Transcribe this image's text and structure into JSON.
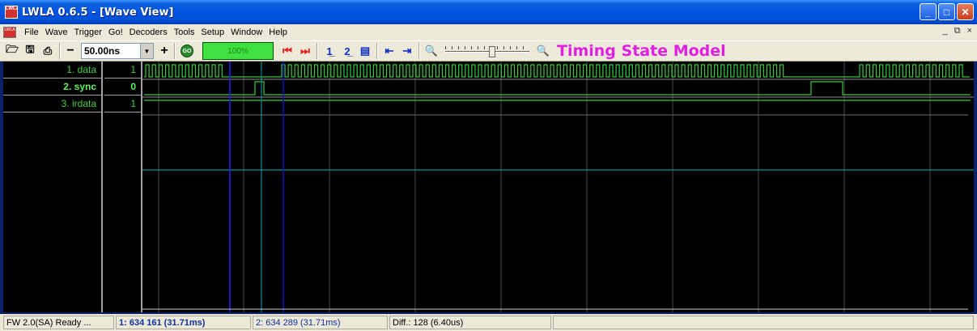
{
  "window": {
    "title": "LWLA 0.6.5 - [Wave View]",
    "icon": "lwla-app-icon"
  },
  "menu": {
    "items": [
      "File",
      "Wave",
      "Trigger",
      "Go!",
      "Decoders",
      "Tools",
      "Setup",
      "Window",
      "Help"
    ],
    "mdi_buttons": [
      "_",
      "⧉",
      "×"
    ]
  },
  "toolbar": {
    "zoom_value": "50.00ns",
    "minus_label": "−",
    "plus_label": "+",
    "go_label": "GO",
    "progress": "100%",
    "model_title": "Timing State Model"
  },
  "signals": [
    {
      "name": "1. data",
      "value": "1"
    },
    {
      "name": "2. sync",
      "value": "0"
    },
    {
      "name": "3. irdata",
      "value": "1"
    }
  ],
  "status": {
    "ready": "FW 2.0(SA) Ready ...",
    "cursor1": "1: 634 161  (31.71ms)",
    "cursor2": "2: 634 289  (31.71ms)",
    "diff": "Diff.: 128  (6.40us)"
  },
  "colors": {
    "trace": "#3cc83c",
    "cursor1": "#2020ff",
    "cursor2": "#1010c0",
    "trigger_line": "#00c0c0",
    "grid": "#505050",
    "model_title": "#e020e0"
  }
}
